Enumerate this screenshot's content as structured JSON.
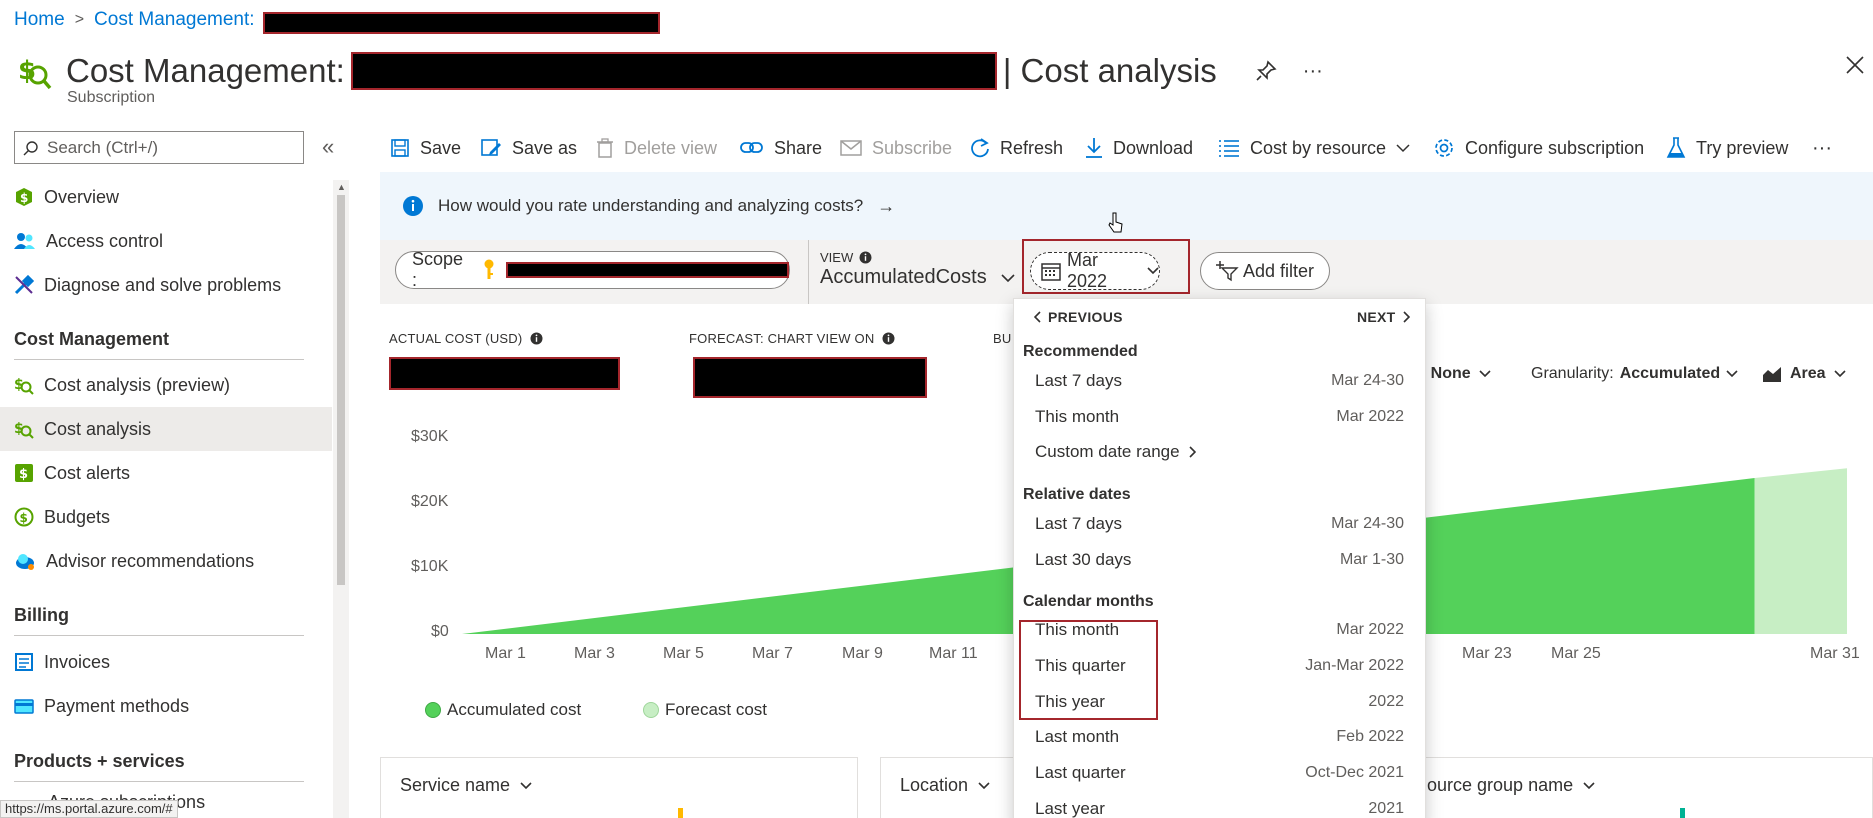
{
  "breadcrumb": {
    "home": "Home",
    "separator": ">",
    "cost_mgmt": "Cost Management:"
  },
  "title": {
    "prefix": "Cost Management:",
    "suffix": "| Cost analysis",
    "subtitle": "Subscription"
  },
  "sidebar": {
    "search_placeholder": "Search (Ctrl+/)",
    "collapse": "«",
    "items_top": [
      {
        "label": "Overview",
        "icon": "dollar-circle-icon",
        "color": "#57a300"
      },
      {
        "label": "Access control",
        "icon": "people-icon",
        "color": "#0078d4"
      },
      {
        "label": "Diagnose and solve problems",
        "icon": "wrench-icon",
        "color": "#0078d4"
      }
    ],
    "section_cost": "Cost Management",
    "items_cost": [
      {
        "label": "Cost analysis (preview)",
        "icon": "cost-analysis-icon"
      },
      {
        "label": "Cost analysis",
        "icon": "cost-analysis-icon",
        "active": true
      },
      {
        "label": "Cost alerts",
        "icon": "cost-alert-icon"
      },
      {
        "label": "Budgets",
        "icon": "budget-icon"
      },
      {
        "label": "Advisor recommendations",
        "icon": "cloud-advisor-icon"
      }
    ],
    "section_billing": "Billing",
    "items_billing": [
      {
        "label": "Invoices",
        "icon": "invoice-icon"
      },
      {
        "label": "Payment methods",
        "icon": "card-icon"
      }
    ],
    "section_products": "Products + services",
    "items_products": [
      {
        "label": "Azure subscriptions"
      }
    ]
  },
  "toolbar": {
    "save": "Save",
    "save_as": "Save as",
    "delete_view": "Delete view",
    "share": "Share",
    "subscribe": "Subscribe",
    "refresh": "Refresh",
    "download": "Download",
    "cost_by_resource": "Cost by resource",
    "configure": "Configure subscription",
    "try_preview": "Try preview",
    "more": "···"
  },
  "banner": {
    "text": "How would you rate understanding and analyzing costs?",
    "arrow": "→"
  },
  "filters": {
    "scope_label": "Scope :",
    "view_label": "VIEW",
    "view_value": "AccumulatedCosts",
    "date_value": "Mar 2022",
    "add_filter": "Add filter"
  },
  "metrics": {
    "actual_cost": "ACTUAL COST (USD)",
    "forecast": "FORECAST: CHART VIEW ON",
    "budget": "BU"
  },
  "chart_controls": {
    "group_by": "y: None",
    "granularity_label": "Granularity:",
    "granularity_value": "Accumulated",
    "chart_type": "Area"
  },
  "chart_data": {
    "type": "area",
    "y_ticks": [
      "$30K",
      "$20K",
      "$10K",
      "$0"
    ],
    "ylim": [
      0,
      30000
    ],
    "x_ticks": [
      "Mar 1",
      "Mar 3",
      "Mar 5",
      "Mar 7",
      "Mar 9",
      "Mar 11",
      "Mar 23",
      "Mar 25",
      "Mar 31"
    ],
    "series": [
      {
        "name": "Accumulated cost",
        "color": "#54d15a",
        "start_day": 1,
        "end_day": 29,
        "start_value": 0,
        "end_value": 24000
      },
      {
        "name": "Forecast cost",
        "color": "#c7eec4",
        "start_day": 29,
        "end_day": 31,
        "start_value": 24000,
        "end_value": 25500
      }
    ]
  },
  "legend": {
    "accumulated": "Accumulated cost",
    "forecast": "Forecast cost"
  },
  "cards": {
    "service": "Service name",
    "location": "Location",
    "resource_group": "ource group name"
  },
  "dropdown": {
    "previous": "PREVIOUS",
    "next": "NEXT",
    "recommended": "Recommended",
    "rec_rows": [
      {
        "label": "Last 7 days",
        "value": "Mar 24-30"
      },
      {
        "label": "This month",
        "value": "Mar 2022"
      },
      {
        "label": "Custom date range",
        "value": ""
      }
    ],
    "relative": "Relative dates",
    "rel_rows": [
      {
        "label": "Last 7 days",
        "value": "Mar 24-30"
      },
      {
        "label": "Last 30 days",
        "value": "Mar 1-30"
      }
    ],
    "calendar": "Calendar months",
    "cal_rows": [
      {
        "label": "This month",
        "value": "Mar 2022"
      },
      {
        "label": "This quarter",
        "value": "Jan-Mar 2022"
      },
      {
        "label": "This year",
        "value": "2022"
      },
      {
        "label": "Last month",
        "value": "Feb 2022"
      },
      {
        "label": "Last quarter",
        "value": "Oct-Dec 2021"
      },
      {
        "label": "Last year",
        "value": "2021"
      }
    ]
  },
  "status_url": "https://ms.portal.azure.com/#"
}
